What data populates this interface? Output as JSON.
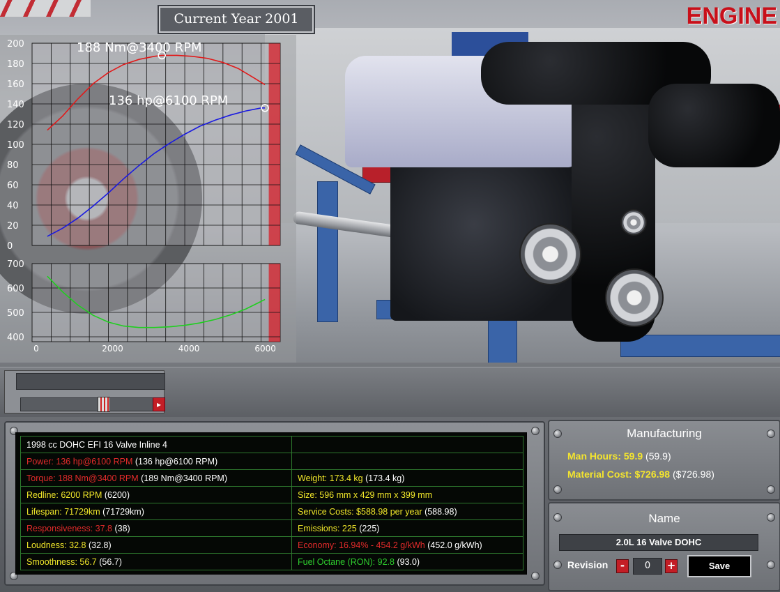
{
  "header": {
    "current_year": "Current Year 2001",
    "section_title": "ENGINE"
  },
  "chart_data": [
    {
      "type": "line",
      "title": "",
      "xlabel": "",
      "ylabel": "",
      "xlim": [
        0,
        6500
      ],
      "ylim": [
        0,
        200
      ],
      "yticks": [
        "0",
        "20",
        "40",
        "60",
        "80",
        "100",
        "120",
        "140",
        "160",
        "180",
        "200"
      ],
      "annotations": [
        "188 Nm@3400 RPM",
        "136 hp@6100 RPM"
      ],
      "series": [
        {
          "color": "#e11a1a",
          "x": [
            400,
            800,
            1200,
            1600,
            2000,
            2400,
            2800,
            3200,
            3400,
            3800,
            4200,
            4600,
            5000,
            5400,
            5800,
            6100
          ],
          "y": [
            114,
            128,
            145,
            160,
            171,
            179,
            184,
            187,
            188,
            188,
            187,
            185,
            181,
            175,
            166,
            159
          ]
        },
        {
          "color": "#1a1ae0",
          "x": [
            400,
            800,
            1200,
            1600,
            2000,
            2400,
            2800,
            3200,
            3600,
            4000,
            4400,
            4800,
            5200,
            5600,
            6000,
            6100
          ],
          "y": [
            9,
            17,
            27,
            39,
            52,
            66,
            79,
            91,
            101,
            110,
            118,
            124,
            129,
            133,
            136,
            136
          ]
        }
      ],
      "redline_from": 6200
    },
    {
      "type": "line",
      "title": "",
      "xlabel": "",
      "ylabel": "",
      "xlim": [
        0,
        6500
      ],
      "ylim": [
        380,
        700
      ],
      "yticks": [
        "400",
        "500",
        "600",
        "700"
      ],
      "xticks": [
        "0",
        "2000",
        "4000",
        "6000"
      ],
      "series": [
        {
          "color": "#1fcf1f",
          "x": [
            400,
            800,
            1200,
            1600,
            2000,
            2400,
            2800,
            3200,
            3600,
            4000,
            4400,
            4800,
            5200,
            5600,
            6000,
            6100
          ],
          "y": [
            648,
            584,
            530,
            488,
            460,
            444,
            438,
            438,
            441,
            447,
            457,
            471,
            490,
            514,
            545,
            553
          ]
        }
      ],
      "redline_from": 6200
    }
  ],
  "stats": {
    "title": "1998 cc DOHC EFI 16 Valve Inline 4",
    "power": {
      "label": "Power: 136 hp@6100 RPM",
      "extra": "(136 hp@6100 RPM)"
    },
    "torque": {
      "label": "Torque: 188 Nm@3400 RPM",
      "extra": "(189 Nm@3400 RPM)"
    },
    "redline": {
      "label": "Redline: 6200 RPM",
      "extra": "(6200)"
    },
    "lifespan": {
      "label": "Lifespan: 71729km",
      "extra": "(71729km)"
    },
    "responsiveness": {
      "label": "Responsiveness: 37.8",
      "extra": "(38)"
    },
    "loudness": {
      "label": "Loudness: 32.8",
      "extra": "(32.8)"
    },
    "smoothness": {
      "label": "Smoothness: 56.7",
      "extra": "(56.7)"
    },
    "weight": {
      "label": "Weight: 173.4 kg",
      "extra": "(173.4 kg)"
    },
    "size": {
      "label": "Size: 596 mm x 429 mm x 399 mm",
      "extra": ""
    },
    "service": {
      "label": "Service Costs: $588.98 per year",
      "extra": "(588.98)"
    },
    "emissions": {
      "label": "Emissions: 225",
      "extra": "(225)"
    },
    "economy": {
      "label": "Economy: 16.94% - 454.2 g/kWh",
      "extra": "(452.0 g/kWh)"
    },
    "octane": {
      "label": "Fuel Octane (RON): 92.8",
      "extra": "(93.0)"
    }
  },
  "manufacturing": {
    "title": "Manufacturing",
    "man_hours_label": "Man Hours: 59.9",
    "man_hours_extra": "(59.9)",
    "material_label": "Material Cost: $726.98",
    "material_extra": "($726.98)"
  },
  "name_panel": {
    "title": "Name",
    "engine_name": "2.0L 16 Valve DOHC",
    "revision_label": "Revision",
    "revision_value": "0",
    "minus": "-",
    "plus": "+",
    "save_label": "Save"
  },
  "colors": {
    "red": "#e32b2b",
    "yellow": "#f1e72a",
    "green": "#2ecf2e",
    "accent_red": "#c31e26"
  }
}
